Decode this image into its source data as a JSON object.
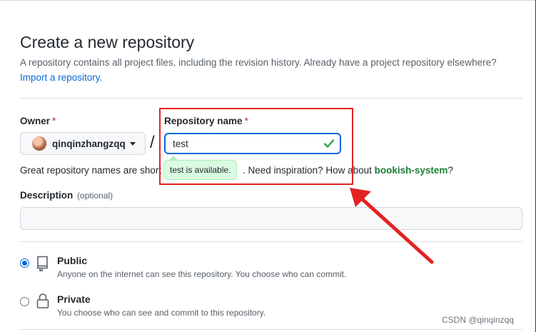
{
  "page": {
    "title": "Create a new repository",
    "subtitle": "A repository contains all project files, including the revision history. Already have a project repository elsewhere?",
    "import_link": "Import a repository."
  },
  "owner": {
    "label": "Owner",
    "required_mark": "*",
    "name": "qinqinzhangzqq"
  },
  "repo": {
    "label": "Repository name",
    "required_mark": "*",
    "value": "test",
    "separator": "/",
    "tooltip": "test is available.",
    "hint_prefix": "Great repository names are short",
    "hint_suffix": ". Need inspiration? How about",
    "suggestion": "bookish-system",
    "hint_end": "?"
  },
  "description": {
    "label": "Description",
    "optional": "(optional)",
    "value": ""
  },
  "visibility": {
    "selected": "public",
    "options": [
      {
        "title": "Public",
        "desc": "Anyone on the internet can see this repository. You choose who can commit.",
        "icon": "repo-icon"
      },
      {
        "title": "Private",
        "desc": "You choose who can see and commit to this repository.",
        "icon": "lock-icon"
      }
    ]
  },
  "watermark": "CSDN @qinqinzqq",
  "colors": {
    "accent": "#0969da",
    "success": "#1a7f37",
    "annotation": "#e52222"
  }
}
